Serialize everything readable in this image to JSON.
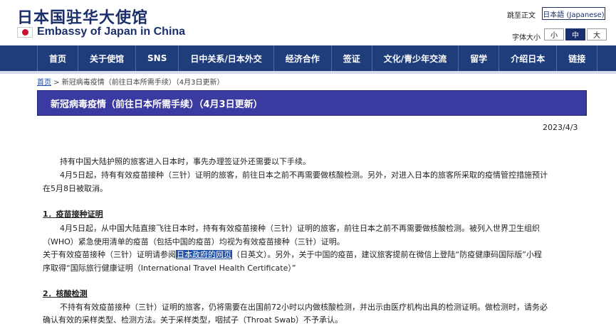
{
  "header": {
    "title_cn": "日本国驻华大使馆",
    "title_en": "Embassy of Japan in China",
    "skip_link": "跳至正文",
    "language_button": "日本語 (Japanese)",
    "font_size_label": "字体大小",
    "font_sizes": [
      "小",
      "中",
      "大"
    ]
  },
  "nav": {
    "items": [
      "首页",
      "关于使馆",
      "SNS",
      "日中关系/日本外交",
      "经济合作",
      "签证",
      "文化/青少年交流",
      "留学",
      "介绍日本",
      "链接"
    ]
  },
  "breadcrumb": {
    "home": "首页",
    "current": " > 新冠病毒疫情（前往日本所需手续）（4月3日更新）"
  },
  "article": {
    "title": "新冠病毒疫情（前往日本所需手续）（4月3日更新）",
    "date": "2023/4/3",
    "intro_1": "持有中国大陆护照的旅客进入日本时，事先办理签证外还需要以下手续。",
    "intro_2a": "4月5日起，持有有效疫苗接种（三针）证明的旅客，前往日本之前不再需要做核酸检测。另外，对进入日本的旅客所采取的疫情管控措施预计",
    "intro_2b": "在5月8日被取消。",
    "section1_heading": "1．疫苗接种证明",
    "section1_p1a": "4月5日起，从中国大陆直接飞往日本时，持有有效疫苗接种（三针）证明的旅客，前往日本之前不再需要做核酸检测。被列入世界卫生组织",
    "section1_p1b": "（WHO）紧急使用清单的疫苗（包括中国的疫苗）均视为有效疫苗接种（三针）证明。",
    "section1_p2_pre": "关于有效疫苗接种（三针）证明请参阅",
    "section1_p2_link": "日本政府的网页",
    "section1_p2_post": "（日英文）。另外，关于中国的疫苗，建议旅客提前在微信上登陆“防疫健康码国际版”小程",
    "section1_p3": "序取得“国际旅行健康证明（International Travel Health Certificate）”",
    "section2_heading": "2．核酸检测",
    "section2_p1a": "不持有有效疫苗接种（三针）证明的旅客，仍将需要在出国前72小时以内做核酸检测，并出示由医疗机构出具的检测证明。做检测时，请务必",
    "section2_p1b": "确认有效的采样类型、检测方法。关于采样类型，咽拭子（Throat Swab）不予承认。"
  },
  "colors": {
    "nav_bg": "#1f3d7a",
    "title_bar_bg": "#3a3aa0",
    "brand_text": "#1a2f6b",
    "link_highlight": "#1d4fa8"
  }
}
